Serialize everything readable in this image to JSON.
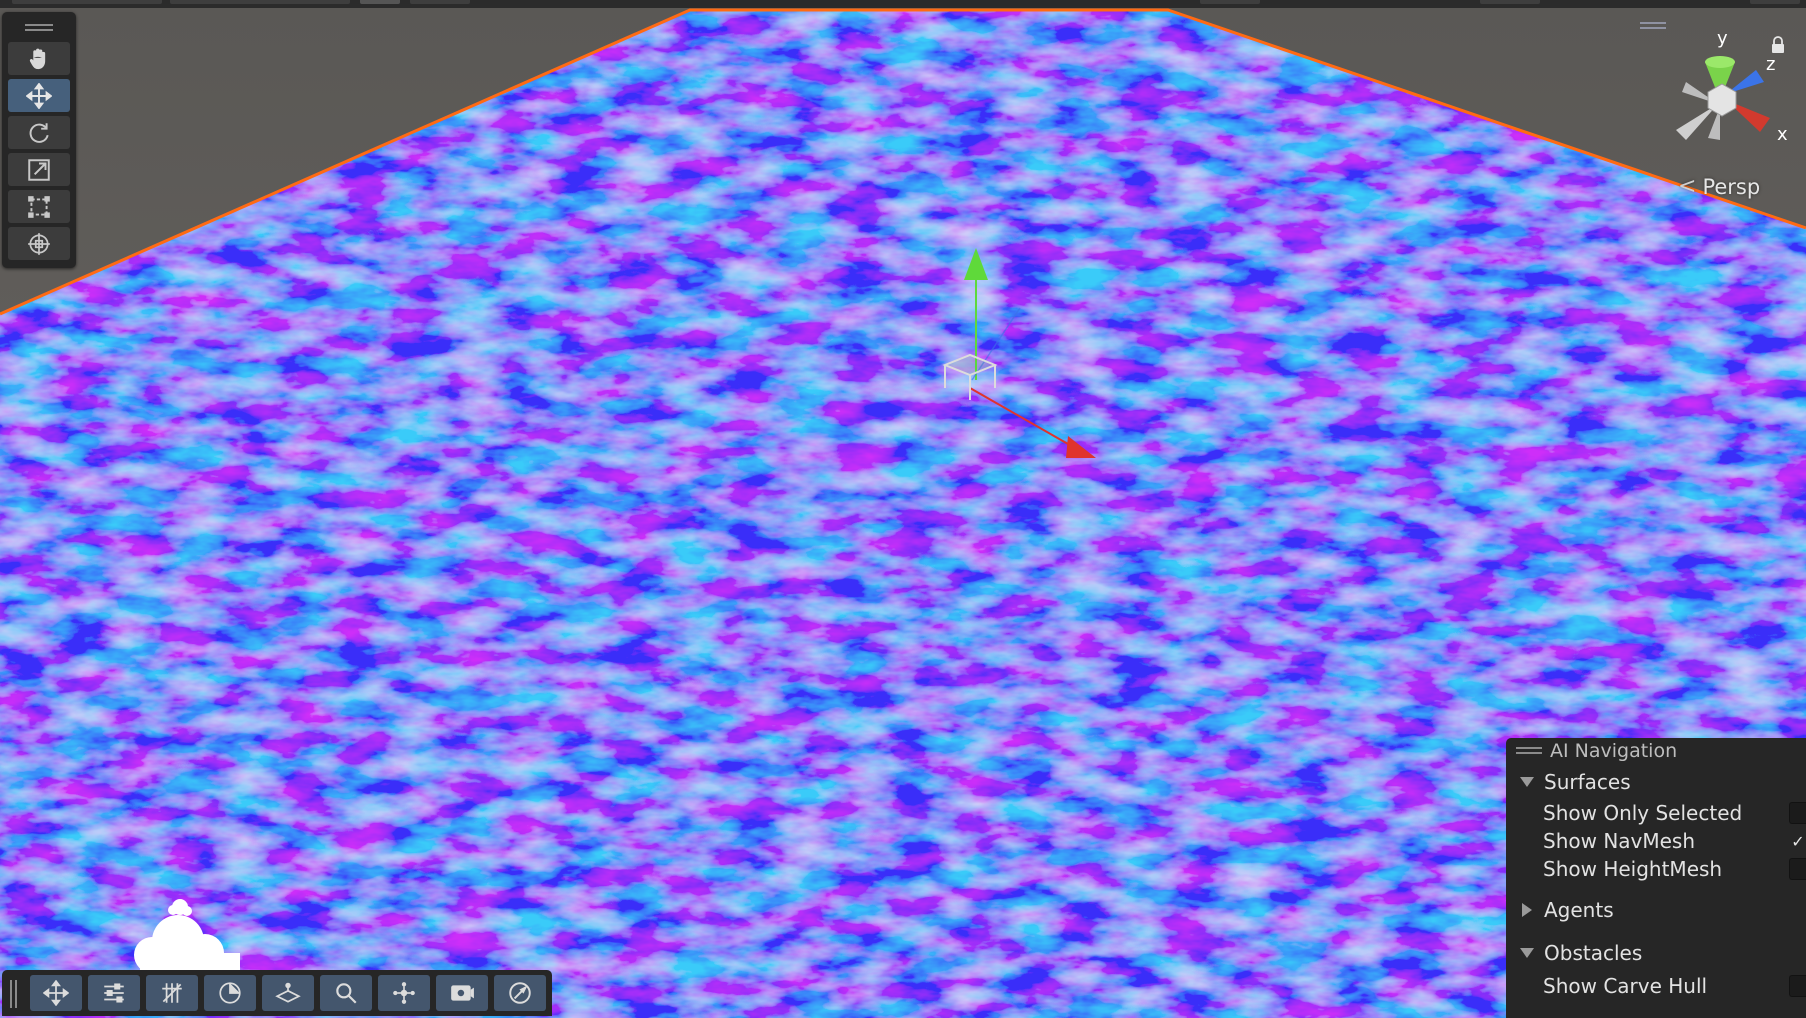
{
  "scene_view": {
    "projection_label": "Persp",
    "axes": {
      "x": "x",
      "y": "y",
      "z": "z"
    },
    "colors": {
      "ground_normal_base": "#3a2ee6",
      "selection_outline": "#ff6a13",
      "sky": "#5f5c58",
      "axis_x": "#e0332d",
      "axis_y": "#5fd93a",
      "axis_z": "#3b74e8"
    }
  },
  "tool_palette": {
    "tools": [
      {
        "name": "hand",
        "icon": "hand-icon",
        "active": false
      },
      {
        "name": "move",
        "icon": "move-icon",
        "active": true
      },
      {
        "name": "rotate",
        "icon": "rotate-icon",
        "active": false
      },
      {
        "name": "scale",
        "icon": "scale-icon",
        "active": false
      },
      {
        "name": "rect",
        "icon": "rect-transform-icon",
        "active": false
      },
      {
        "name": "transform",
        "icon": "transform-icon",
        "active": false
      }
    ]
  },
  "overlay_toolbar": {
    "buttons": [
      {
        "icon": "move-overlay-icon"
      },
      {
        "icon": "tool-settings-icon"
      },
      {
        "icon": "grid-snapping-icon"
      },
      {
        "icon": "orientation-icon"
      },
      {
        "icon": "navmesh-surface-icon"
      },
      {
        "icon": "search-icon"
      },
      {
        "icon": "view-options-icon"
      },
      {
        "icon": "camera-icon"
      },
      {
        "icon": "compass-icon"
      }
    ]
  },
  "ai_navigation": {
    "title": "AI Navigation",
    "surfaces": {
      "label": "Surfaces",
      "expanded": true,
      "options": [
        {
          "label": "Show Only Selected",
          "checked": false
        },
        {
          "label": "Show NavMesh",
          "checked": true
        },
        {
          "label": "Show HeightMesh",
          "checked": false
        }
      ]
    },
    "agents": {
      "label": "Agents",
      "expanded": false
    },
    "obstacles": {
      "label": "Obstacles",
      "expanded": true,
      "options": [
        {
          "label": "Show Carve Hull",
          "checked": false
        }
      ]
    },
    "check_mark": "✓"
  }
}
